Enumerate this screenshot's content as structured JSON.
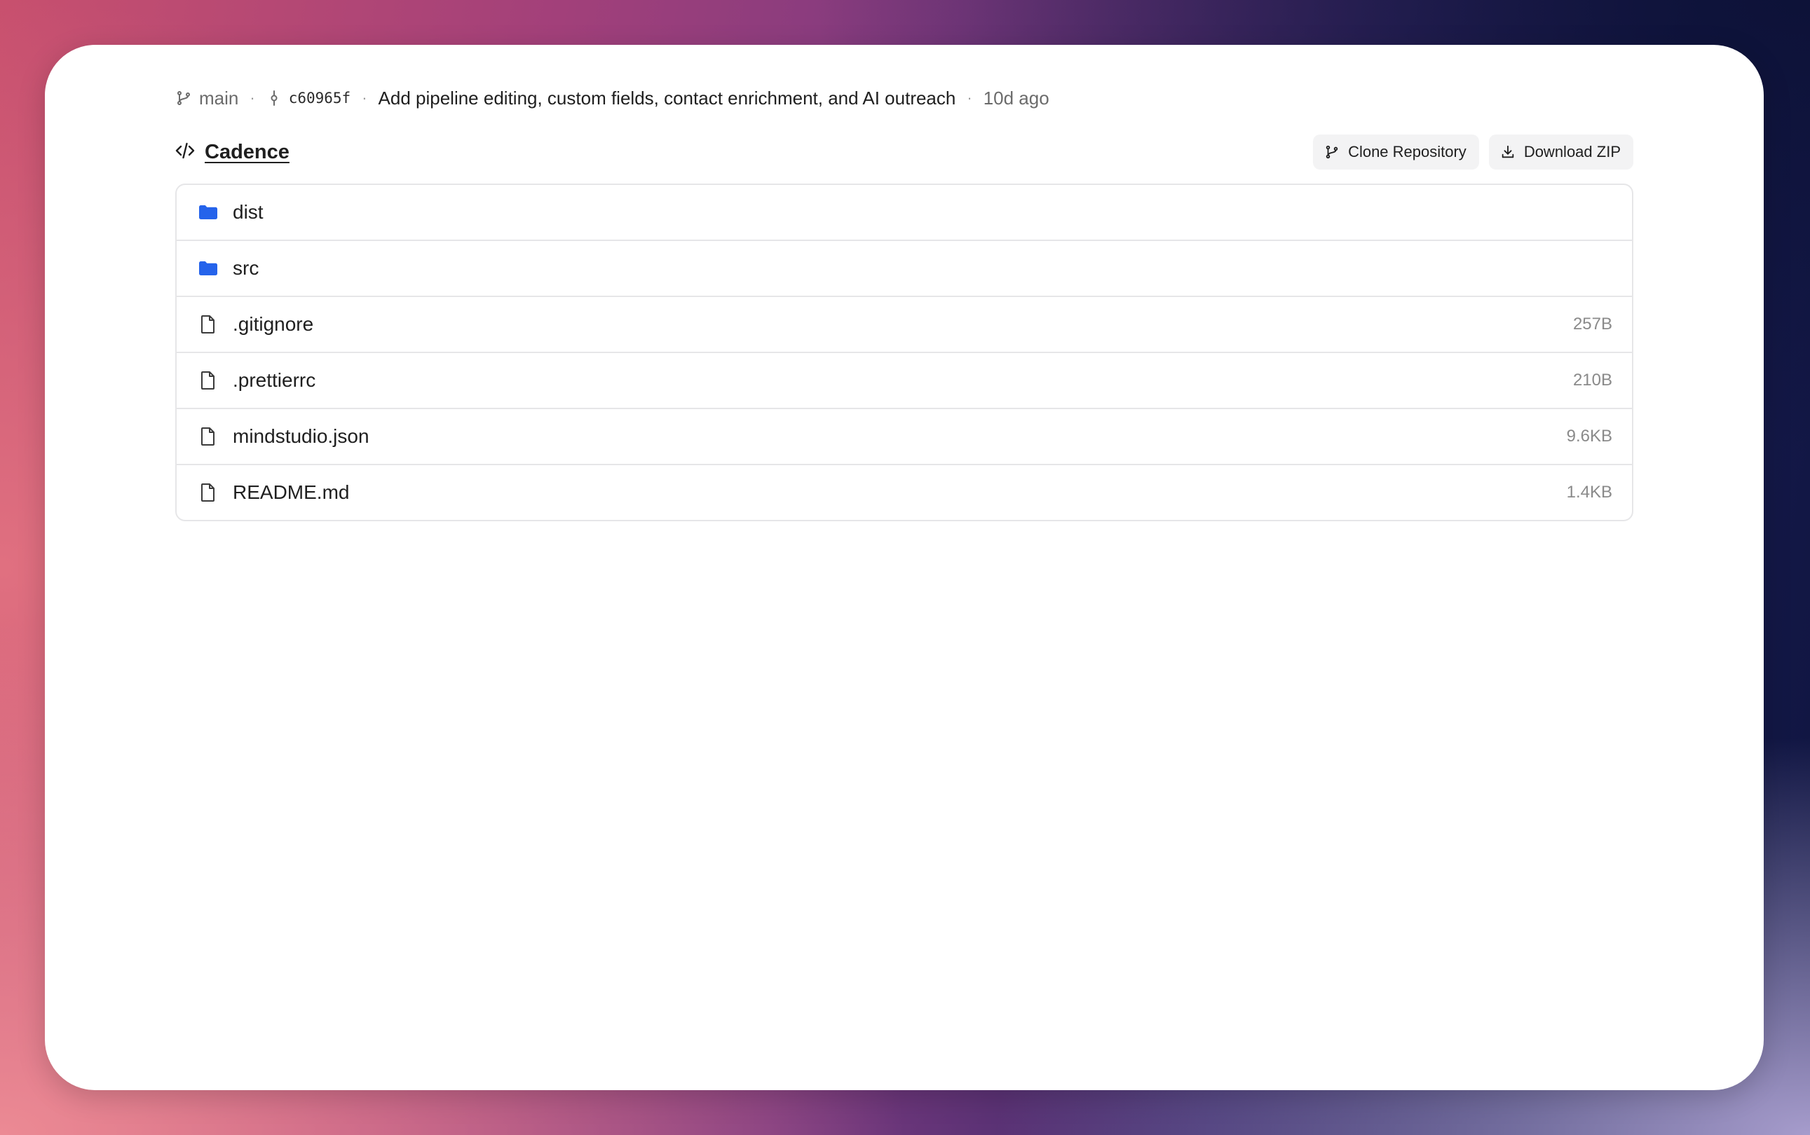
{
  "colors": {
    "folder": "#2563eb",
    "text": "#1f1f1f",
    "muted": "#6b6b6b",
    "border": "#e6e6e8",
    "button_bg": "#f3f3f4"
  },
  "commit": {
    "branch": "main",
    "hash": "c60965f",
    "message": "Add pipeline editing, custom fields, contact enrichment, and AI outreach",
    "time": "10d ago"
  },
  "repo": {
    "name": "Cadence",
    "icon": "code-icon"
  },
  "actions": {
    "clone_label": "Clone Repository",
    "download_label": "Download ZIP"
  },
  "files": [
    {
      "name": "dist",
      "type": "folder",
      "size": ""
    },
    {
      "name": "src",
      "type": "folder",
      "size": ""
    },
    {
      "name": ".gitignore",
      "type": "file",
      "size": "257B"
    },
    {
      "name": ".prettierrc",
      "type": "file",
      "size": "210B"
    },
    {
      "name": "mindstudio.json",
      "type": "file",
      "size": "9.6KB"
    },
    {
      "name": "README.md",
      "type": "file",
      "size": "1.4KB"
    }
  ]
}
